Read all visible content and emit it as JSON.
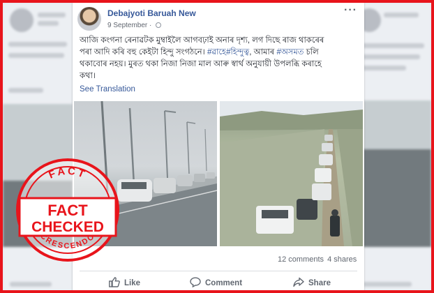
{
  "post": {
    "author": "Debajyoti Baruah New",
    "date": "9 September",
    "text_line1": "আজি কংগনা ৰেনাৱটক মুম্বাইলৈ আগবঢ়াই অনাৰ দৃশ্য, লগ দিছে ৰাজ থাকৰেৰ",
    "text_line2a": "পৰা আদি কৰি বহু কেইটা হিন্দু সংগঠনে। ",
    "hashtag1": "#ৱাহে",
    "hashtag2": "#হিন্দুত্ব",
    "text_line2b": ", আমাৰ ",
    "hashtag3": "#অসমত",
    "text_line2c": " চলি",
    "text_line3": "থকাবোৰ নহয়। মুৰত থকা নিজা নিজা মাল আৰু স্বাৰ্থ অনুযায়ী উপলব্ধি কৰাহে",
    "text_line4": "কথা।",
    "see_translation": "See Translation",
    "comments": "12 comments",
    "shares": "4 shares",
    "actions": {
      "like": "Like",
      "comment": "Comment",
      "share": "Share"
    }
  },
  "stamp": {
    "top_text": "FACT",
    "main1": "FACT",
    "main2": "CHECKED",
    "bottom_text": "CRESCENDO"
  },
  "colors": {
    "link": "#365899",
    "stamp_red": "#e8141b",
    "text": "#1d2129",
    "muted": "#616770"
  }
}
